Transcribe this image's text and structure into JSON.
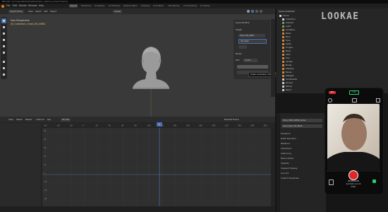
{
  "window": {
    "title": "Blender* [C:\\Users\\Work\\Desktop\\face_capture_project.blend]"
  },
  "menu": [
    "File",
    "Edit",
    "Render",
    "Window",
    "Help"
  ],
  "workspaces": [
    "Layout",
    "Modeling",
    "Sculpting",
    "UV Editing",
    "Texture Paint",
    "Shading",
    "Animation",
    "Rendering",
    "Compositing",
    "Scripting"
  ],
  "active_workspace": "Layout",
  "viewport": {
    "mode": "Object Mode",
    "menus": [
      "View",
      "Select",
      "Add",
      "Object"
    ],
    "transform": "Global",
    "overlay_line1": "User Perspective",
    "overlay_line2": "(0) Collection | head_HD_ARKit",
    "panel": {
      "title": "Live Link Face",
      "label_target": "Target",
      "field_1": "head_HD_ARKit",
      "field_2": "HD_Mesh",
      "label_model": "Model",
      "label_port": "Port",
      "port_value": "11111",
      "tooltip": "Listen animation dataport"
    }
  },
  "outliner": {
    "title": "Scene Collection",
    "items": [
      "Scene",
      "Collection",
      "Camera",
      "Light",
      "Armature",
      "Mesh",
      "Face",
      "Eyes",
      "Teeth",
      "Tongue",
      "Body",
      "Shirt",
      "Hair",
      "Lashes",
      "Brows",
      "Shaders",
      "Bones",
      "Widgets",
      "Constraints",
      "Drivers",
      "Extras",
      "World",
      "Stuff",
      "Helpers",
      "Ref",
      "Misc"
    ]
  },
  "properties": {
    "field_1": "Pinky_Shift_00054_Gross",
    "field_2": "head_leam_HD_Mesh",
    "rows": [
      "Transform",
      "Delta Transform",
      "Relations",
      "Collections",
      "Instancing",
      "Motion Paths",
      "Visibility",
      "Viewport Display",
      "Line Art",
      "Custom Properties"
    ]
  },
  "timeline": {
    "menus": [
      "View",
      "Select",
      "Marker",
      "Channel",
      "Key"
    ],
    "editor_mode": "Normal",
    "playback": "Nearest Frame",
    "ticks": [
      "-60",
      "-40",
      "-20",
      "0",
      "20",
      "40",
      "60",
      "80",
      "100",
      "120",
      "140",
      "160",
      "180",
      "200",
      "220",
      "240",
      "260",
      "280"
    ],
    "y_labels": [
      "50",
      "40",
      "30",
      "20",
      "10",
      "0",
      "-10",
      "-20",
      "-30"
    ],
    "current_frame": "0"
  },
  "phone": {
    "rec_badge": "REC",
    "timecode_top": "00:03",
    "status": "LIVE",
    "timecode": "00:00:00:00",
    "caption": "Synthetic Live 4K",
    "fps": "60fps"
  },
  "brand": {
    "logo": "LOOKAE"
  },
  "colors": {
    "accent": "#4772b3",
    "active_tab": "#3b3b3b",
    "record": "#e02626",
    "live": "#2ecc71",
    "keyframe": "#f0c040"
  }
}
